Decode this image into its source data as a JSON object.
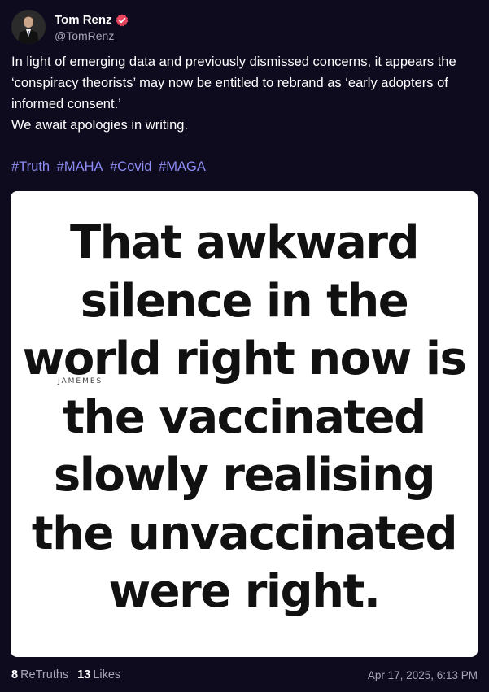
{
  "author": {
    "display_name": "Tom Renz",
    "handle": "@TomRenz",
    "verified": true,
    "verified_color": "#e8465f"
  },
  "post": {
    "body_lines": [
      "In light of emerging data and previously dismissed concerns, it appears the ‘conspiracy theorists’ may now be entitled to rebrand as ‘early adopters of informed consent.’",
      "We await apologies in writing."
    ],
    "hashtags": [
      "#Truth",
      "#MAHA",
      "#Covid",
      "#MAGA"
    ],
    "hashtag_color": "#8d8cf5"
  },
  "media": {
    "meme_lines": [
      "That awkward",
      "silence in the",
      "world right now is",
      "the vaccinated",
      "slowly realising",
      "the unvaccinated",
      "were right."
    ],
    "watermark": "JAMEMES"
  },
  "footer": {
    "retruths_count": "8",
    "retruths_label": "ReTruths",
    "likes_count": "13",
    "likes_label": "Likes",
    "timestamp": "Apr 17, 2025, 6:13 PM"
  },
  "colors": {
    "background": "#0e0b1f",
    "muted_text": "#a8a5b8"
  }
}
